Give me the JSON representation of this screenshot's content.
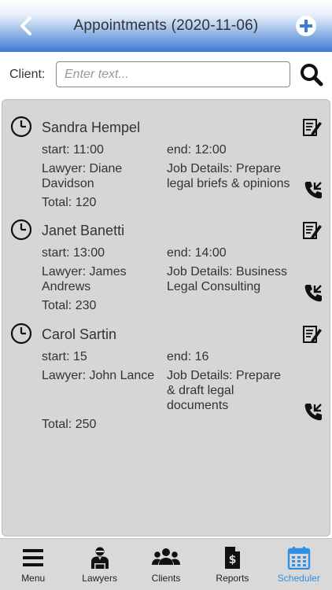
{
  "header": {
    "title": "Appointments (2020-11-06)"
  },
  "search": {
    "label": "Client:",
    "placeholder": "Enter text...",
    "value": ""
  },
  "appointments": [
    {
      "name": "Sandra Hempel",
      "start": "start: 11:00",
      "end": "end: 12:00",
      "lawyer": [
        "Lawyer: Diane",
        "Davidson"
      ],
      "job": [
        "Job Details: Prepare",
        "legal briefs & opinions"
      ],
      "total": "Total: 120"
    },
    {
      "name": "Janet Banetti",
      "start": "start: 13:00",
      "end": "end: 14:00",
      "lawyer": [
        "Lawyer: James",
        "Andrews"
      ],
      "job": [
        "Job Details: Business",
        "Legal Consulting"
      ],
      "total": "Total: 230"
    },
    {
      "name": "Carol Sartin",
      "start": "start: 15",
      "end": "end: 16",
      "lawyer": [
        "Lawyer: John Lance"
      ],
      "job": [
        "Job Details: Prepare",
        "& draft legal",
        "documents"
      ],
      "total": "Total: 250"
    }
  ],
  "tabs": [
    {
      "label": "Menu",
      "icon": "hamburger-icon"
    },
    {
      "label": "Lawyers",
      "icon": "lawyer-icon"
    },
    {
      "label": "Clients",
      "icon": "users-icon"
    },
    {
      "label": "Reports",
      "icon": "report-icon"
    },
    {
      "label": "Scheduler",
      "icon": "calendar-icon",
      "active": true
    }
  ],
  "colors": {
    "accent": "#2f8fe0",
    "header_bottom": "#3f7ad4",
    "panel": "#d6d6d6"
  }
}
